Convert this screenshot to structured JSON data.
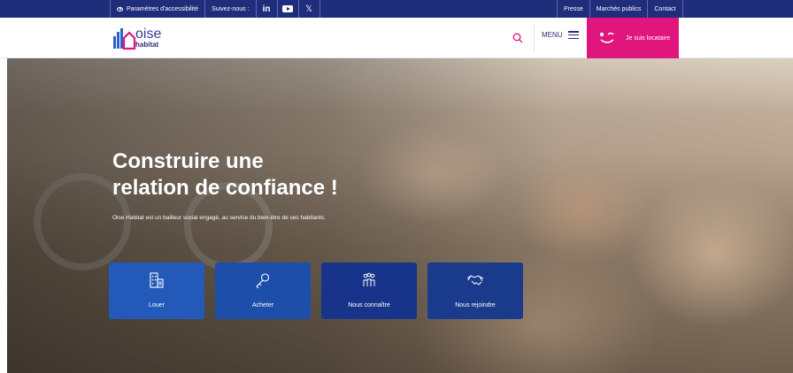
{
  "topbar": {
    "accessibility_label": "Paramètres d'accessibilité",
    "follow_label": "Suivez-nous :",
    "social": [
      "linkedin-icon",
      "youtube-icon",
      "x-icon"
    ],
    "right_links": [
      "Presse",
      "Marchés publics",
      "Contact"
    ]
  },
  "header": {
    "logo_line1": "oise",
    "logo_line2": "habitat",
    "menu_label": "MENU",
    "locataire_label": "Je suis locataire"
  },
  "hero": {
    "title_line1": "Construire une",
    "title_line2": "relation de confiance !",
    "subtitle": "Oise Habitat est un bailleur social engagé, au service du bien-être de ses habitants.",
    "cards": [
      {
        "label": "Louer",
        "icon": "building-icon"
      },
      {
        "label": "Acheter",
        "icon": "key-icon"
      },
      {
        "label": "Nous connaître",
        "icon": "people-icon"
      },
      {
        "label": "Nous rejoindre",
        "icon": "handshake-icon"
      }
    ]
  },
  "colors": {
    "navy": "#1f2d7a",
    "pink": "#e0157d",
    "card_blue": "#2359b8",
    "card_dark": "#17348a"
  }
}
